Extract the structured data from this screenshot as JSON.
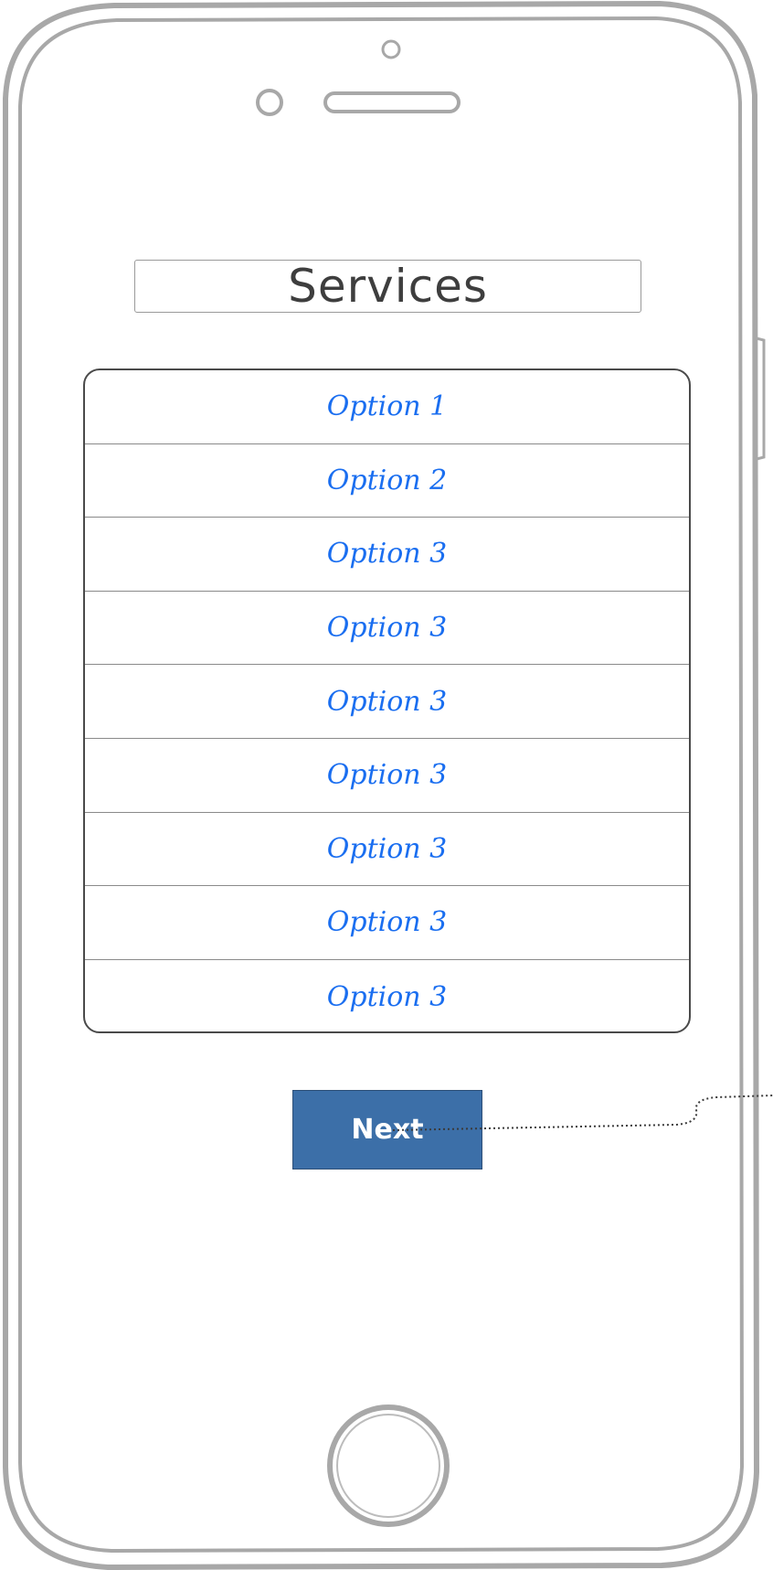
{
  "screen": {
    "title": "Services"
  },
  "options": {
    "items": [
      {
        "label": "Option 1"
      },
      {
        "label": "Option 2"
      },
      {
        "label": "Option 3"
      },
      {
        "label": "Option 3"
      },
      {
        "label": "Option 3"
      },
      {
        "label": "Option 3"
      },
      {
        "label": "Option 3"
      },
      {
        "label": "Option 3"
      },
      {
        "label": "Option 3"
      }
    ]
  },
  "actions": {
    "next_label": "Next"
  },
  "colors": {
    "option_text": "#1a6ef0",
    "button_fill": "#3c6fa8",
    "button_text": "#ffffff",
    "frame_stroke": "#a8a8a8"
  },
  "icons": {
    "camera": "camera-icon",
    "sensor": "sensor-dot-icon",
    "speaker": "speaker-grille-icon",
    "home": "home-button-icon"
  }
}
